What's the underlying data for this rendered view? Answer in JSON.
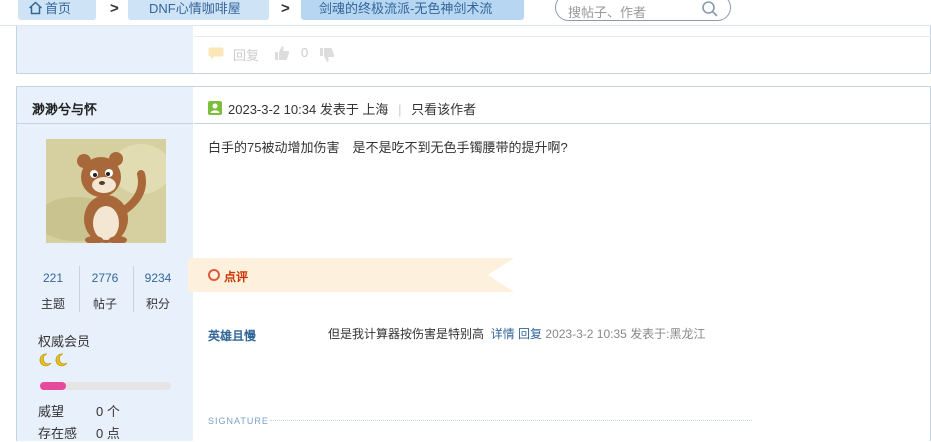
{
  "breadcrumb": {
    "home": "首页",
    "forum": "DNF心情咖啡屋",
    "thread": "剑魂的终极流派-无色神剑术流"
  },
  "search": {
    "placeholder": "搜帖子、作者"
  },
  "prev_post": {
    "reply_label": "回复",
    "like_count": "0"
  },
  "post": {
    "username": "渺渺兮与怀",
    "stats": [
      {
        "value": "221",
        "label": "主题"
      },
      {
        "value": "2776",
        "label": "帖子"
      },
      {
        "value": "9234",
        "label": "积分"
      }
    ],
    "user_group": "权威会员",
    "level_progress": 0.2,
    "prestige_label": "威望",
    "prestige_value": "0 个",
    "presence_label": "存在感",
    "presence_value": "0 点",
    "date": "2023-3-2 10:34",
    "posted_at": "发表于 上海",
    "only_author": "只看该作者",
    "content": "白手的75被动增加伤害　是不是吃不到无色手镯腰带的提升啊?",
    "comment_header": "点评",
    "comment": {
      "user": "英雄且慢",
      "text": "但是我计算器按伤害是特别高",
      "detail": "详情",
      "reply": "回复",
      "meta": "2023-3-2 10:35 发表于:黑龙江"
    },
    "signature_label": "SIGNATURE"
  },
  "colors": {
    "link": "#336699",
    "crumb_bg": "#cfe3f7",
    "sidebar_bg": "#e8f1fb",
    "comment_red": "#cc3300",
    "banner": "#fdf1de",
    "progress": "#e64a9c"
  }
}
